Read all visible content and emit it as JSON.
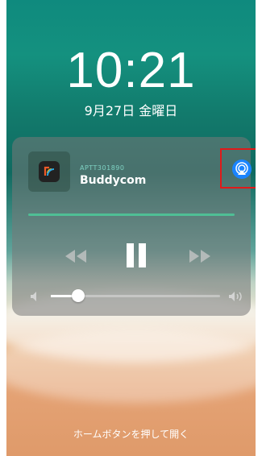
{
  "lockscreen": {
    "time": "10:21",
    "date": "9月27日 金曜日",
    "unlock_hint": "ホームボタンを押して開く"
  },
  "now_playing": {
    "subtitle": "APTT301890",
    "title": "Buddycom",
    "app_icon": "buddycom-icon",
    "airplay_icon": "airplay-icon",
    "highlight_color": "#e01a1a",
    "accent_color": "#1a84ff",
    "progress_color": "#4fbf95",
    "volume_level": 0.15
  }
}
